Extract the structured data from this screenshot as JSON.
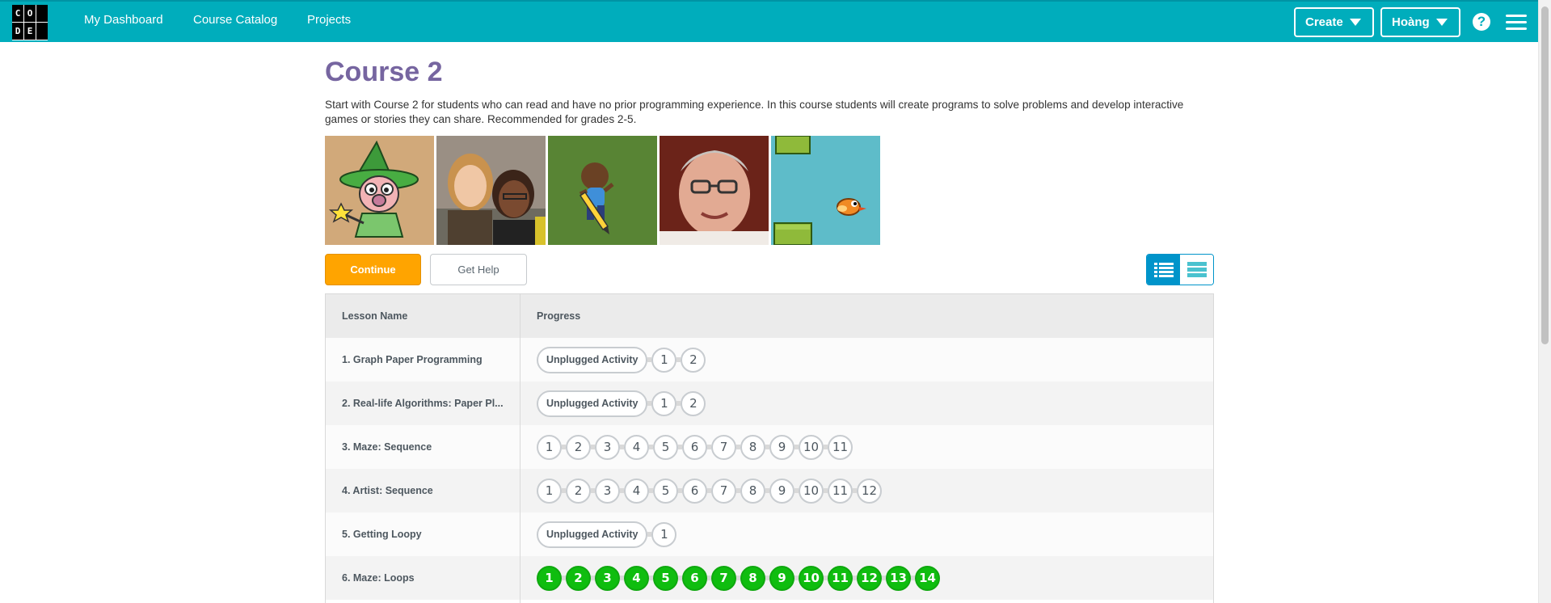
{
  "header": {
    "logo_letters": [
      "C",
      "O",
      "",
      "D",
      "E",
      ""
    ],
    "nav": [
      "My Dashboard",
      "Course Catalog",
      "Projects"
    ],
    "create_label": "Create",
    "user_label": "Hoàng",
    "help_glyph": "?"
  },
  "course": {
    "title": "Course 2",
    "description": "Start with Course 2 for students who can read and have no prior programming experience. In this course students will create programs to solve problems and develop interactive games or stories they can share. Recommended for grades 2-5.",
    "continue_label": "Continue",
    "get_help_label": "Get Help"
  },
  "table": {
    "col_lesson": "Lesson Name",
    "col_progress": "Progress",
    "rows": [
      {
        "name": "1. Graph Paper Programming",
        "unplugged": "Unplugged Activity",
        "levels": [
          "1",
          "2"
        ],
        "done": false
      },
      {
        "name": "2. Real-life Algorithms: Paper Pl...",
        "unplugged": "Unplugged Activity",
        "levels": [
          "1",
          "2"
        ],
        "done": false
      },
      {
        "name": "3. Maze: Sequence",
        "unplugged": "",
        "levels": [
          "1",
          "2",
          "3",
          "4",
          "5",
          "6",
          "7",
          "8",
          "9",
          "10",
          "11"
        ],
        "done": false
      },
      {
        "name": "4. Artist: Sequence",
        "unplugged": "",
        "levels": [
          "1",
          "2",
          "3",
          "4",
          "5",
          "6",
          "7",
          "8",
          "9",
          "10",
          "11",
          "12"
        ],
        "done": false
      },
      {
        "name": "5. Getting Loopy",
        "unplugged": "Unplugged Activity",
        "levels": [
          "1"
        ],
        "done": false
      },
      {
        "name": "6. Maze: Loops",
        "unplugged": "",
        "levels": [
          "1",
          "2",
          "3",
          "4",
          "5",
          "6",
          "7",
          "8",
          "9",
          "10",
          "11",
          "12",
          "13",
          "14"
        ],
        "done": true
      }
    ]
  },
  "colors": {
    "header_bg": "#00adbc",
    "title": "#7665a0",
    "continue_bg": "#ffa400",
    "complete_green": "#0fbd0f",
    "toggle_active": "#0094ca"
  },
  "icons": {
    "help": "help-icon",
    "menu": "hamburger-menu-icon",
    "dropdown": "caret-down-icon",
    "list_view": "list-view-icon",
    "table_view": "table-view-icon"
  }
}
